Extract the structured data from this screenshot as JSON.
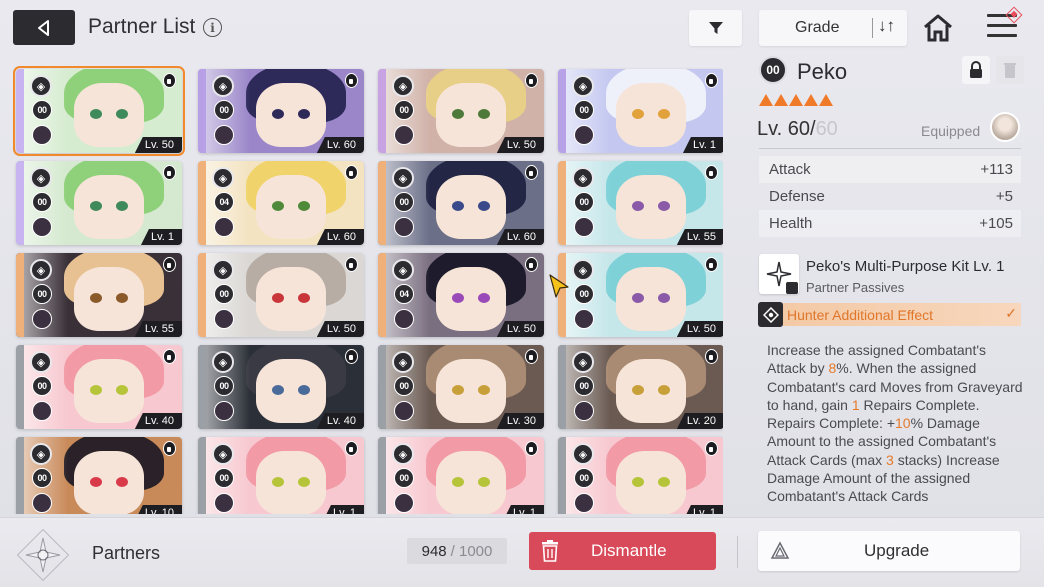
{
  "header": {
    "title": "Partner List",
    "info_icon": "i",
    "sort_label": "Grade",
    "sort_icon": "↓↑"
  },
  "cards": [
    {
      "level": "Lv. 50",
      "rank": "00",
      "hair": "#8fd07a",
      "bg": "#d6ecd0",
      "stripe": "#c8b4f0",
      "eye": "#3f8a5a",
      "selected": true
    },
    {
      "level": "Lv. 60",
      "rank": "00",
      "hair": "#2d2a5a",
      "bg": "#9a86c9",
      "stripe": "#b8a0e6",
      "eye": "#2d2a5a"
    },
    {
      "level": "Lv. 50",
      "rank": "00",
      "hair": "#e8cf88",
      "bg": "#d0b2a8",
      "stripe": "#c7a3e4",
      "eye": "#4d7a3a"
    },
    {
      "level": "Lv. 1",
      "rank": "00",
      "hair": "#eef0fa",
      "bg": "#c4c8f0",
      "stripe": "#b7a2e8",
      "eye": "#e1a23c"
    },
    {
      "level": "Lv. 1",
      "rank": "00",
      "hair": "#8fd07a",
      "bg": "#d4e9cf",
      "stripe": "#c8b4f0",
      "eye": "#3f8a5a"
    },
    {
      "level": "Lv. 60",
      "rank": "04",
      "hair": "#f0d36a",
      "bg": "#f3e3c1",
      "stripe": "#efb07a",
      "eye": "#4f8a3a"
    },
    {
      "level": "Lv. 60",
      "rank": "00",
      "hair": "#232645",
      "bg": "#6b6f88",
      "stripe": "#efb07a",
      "eye": "#3a4a8a"
    },
    {
      "level": "Lv. 55",
      "rank": "00",
      "hair": "#7fd1d8",
      "bg": "#c6e7ea",
      "stripe": "#efb07a",
      "eye": "#8a5aa8"
    },
    {
      "level": "Lv. 55",
      "rank": "00",
      "hair": "#e8c192",
      "bg": "#3a3038",
      "stripe": "#efb07a",
      "eye": "#8a5a2a"
    },
    {
      "level": "Lv. 50",
      "rank": "00",
      "hair": "#b8ada4",
      "bg": "#dad7d4",
      "stripe": "#efb07a",
      "eye": "#c8363a"
    },
    {
      "level": "Lv. 50",
      "rank": "04",
      "hair": "#1e1c2c",
      "bg": "#7a6f80",
      "stripe": "#efb07a",
      "eye": "#9a4ab8"
    },
    {
      "level": "Lv. 50",
      "rank": "00",
      "hair": "#7fd1d8",
      "bg": "#c6e7ea",
      "stripe": "#efb07a",
      "eye": "#8a5aa8"
    },
    {
      "level": "Lv. 40",
      "rank": "00",
      "hair": "#f29aa6",
      "bg": "#f7c8cf",
      "stripe": "#9aa0a6",
      "eye": "#b6c43a"
    },
    {
      "level": "Lv. 40",
      "rank": "00",
      "hair": "#3a3a44",
      "bg": "#2b3038",
      "stripe": "#9aa0a6",
      "eye": "#4a6a9a"
    },
    {
      "level": "Lv. 30",
      "rank": "00",
      "hair": "#a98a72",
      "bg": "#6a5a52",
      "stripe": "#9aa0a6",
      "eye": "#c8a03a"
    },
    {
      "level": "Lv. 20",
      "rank": "00",
      "hair": "#a98a72",
      "bg": "#6a5a52",
      "stripe": "#9aa0a6",
      "eye": "#c8a03a"
    },
    {
      "level": "Lv. 10",
      "rank": "00",
      "hair": "#2a2228",
      "bg": "#c98a5a",
      "stripe": "#9aa0a6",
      "eye": "#d83a4a"
    },
    {
      "level": "Lv. 1",
      "rank": "00",
      "hair": "#f29aa6",
      "bg": "#f7c8cf",
      "stripe": "#9aa0a6",
      "eye": "#b6c43a"
    },
    {
      "level": "Lv. 1",
      "rank": "00",
      "hair": "#f29aa6",
      "bg": "#f7c8cf",
      "stripe": "#9aa0a6",
      "eye": "#b6c43a"
    },
    {
      "level": "Lv. 1",
      "rank": "00",
      "hair": "#f29aa6",
      "bg": "#f7c8cf",
      "stripe": "#9aa0a6",
      "eye": "#b6c43a"
    }
  ],
  "detail": {
    "rank": "00",
    "name": "Peko",
    "stars": 5,
    "level_current": "Lv. 60/",
    "level_max": "60",
    "equipped_label": "Equipped",
    "stats": [
      {
        "label": "Attack",
        "value": "+113"
      },
      {
        "label": "Defense",
        "value": "+5"
      },
      {
        "label": "Health",
        "value": "+105"
      }
    ],
    "kit_title": "Peko's Multi-Purpose Kit Lv. 1",
    "kit_subtitle": "Partner Passives",
    "hunter_label": "Hunter Additional Effect",
    "hunter_check": "✓",
    "desc_parts": {
      "p1": "Increase the assigned Combatant's Attack by ",
      "h1": "8",
      "p2": "%. When the assigned Combatant's card Moves from Graveyard to hand, gain ",
      "h2": "1",
      "p3": " Repairs Complete. Repairs Complete: +",
      "h3": "10",
      "p4": "% Damage Amount to the assigned Combatant's Attack Cards (max ",
      "h4": "3",
      "p5": " stacks) Increase Damage Amount of the assigned Combatant's Attack Cards"
    }
  },
  "bottom": {
    "partners_label": "Partners",
    "count_current": "948",
    "count_total": "/ 1000",
    "dismantle_label": "Dismantle",
    "upgrade_label": "Upgrade"
  },
  "colors": {
    "accent_orange": "#ef7a2a",
    "dismantle_red": "#d84a5a",
    "dark": "#2b2b30"
  }
}
